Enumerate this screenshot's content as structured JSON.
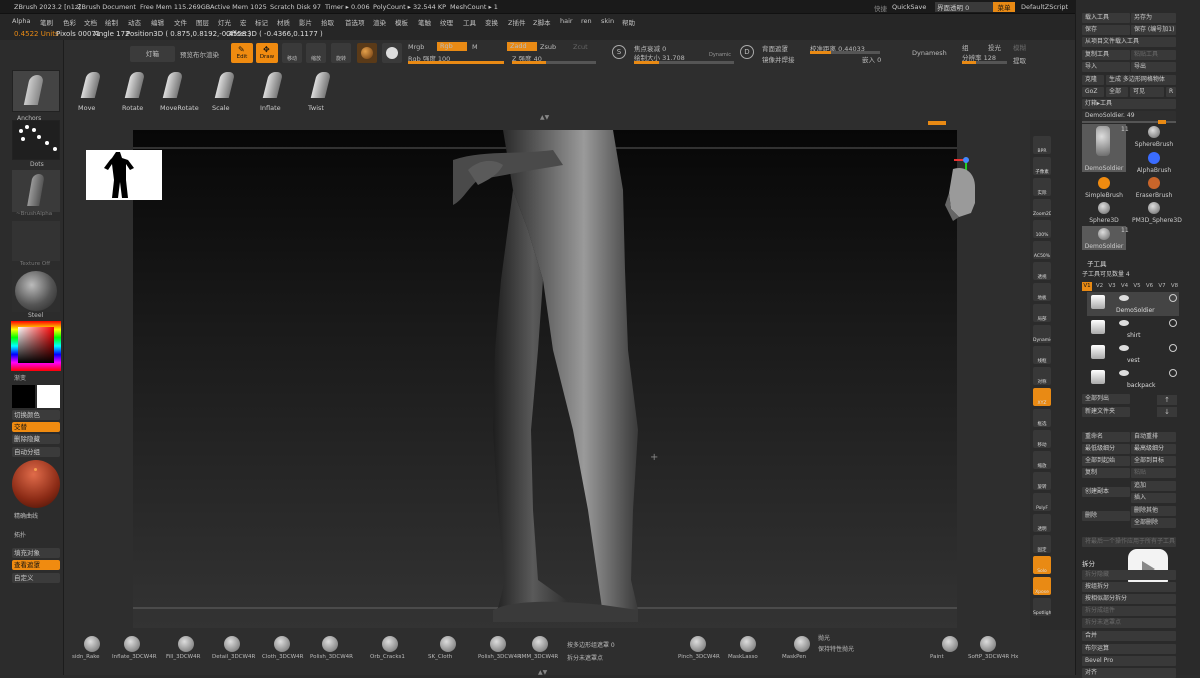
{
  "title_bar": {
    "app": "ZBrush 2023.2 [n1z]",
    "doc": "ZBrush Document",
    "free_mem": "Free Mem 115.269GB",
    "active_mem": "Active Mem 1025",
    "scratch": "Scratch Disk 97",
    "timer": "Timer ▸ 0.006",
    "polycount": "PolyCount ▸ 32.544 KP",
    "meshcount": "MeshCount ▸ 1",
    "quicksave_label": "快捷",
    "quicksave": "QuickSave",
    "transparency": "界面透明 0",
    "menu_btn": "菜单",
    "script": "DefaultZScript"
  },
  "menu": [
    "Alpha",
    "笔刷",
    "色彩",
    "文档",
    "绘制",
    "动态",
    "编辑",
    "文件",
    "图层",
    "灯光",
    "宏",
    "标记",
    "材质",
    "影片",
    "拾取",
    "首选项",
    "渲染",
    "模板",
    "笔触",
    "纹理",
    "工具",
    "变换",
    "Z插件",
    "Z脚本",
    "hair",
    "ren",
    "skin",
    "帮助"
  ],
  "info": {
    "units": "0.4522 Units",
    "pixols": "Pixols 00071",
    "angle": "Angle 172",
    "position": "Position3D ( 0.875,0.8192,-0.4558 )",
    "offset": "Offset3D ( -0.4366,0.1177 )"
  },
  "top_shelf": {
    "light_box": "灯箱",
    "preview_render": "预览布尔渲染",
    "edit": "Edit",
    "draw": "Draw",
    "move_t": "移动",
    "scale_t": "缩放",
    "rotate_t": "旋转",
    "mrgb": "Mrgb",
    "rgb": "Rgb",
    "m": "M",
    "rgb_intensity": "Rgb 强度 100",
    "zadd": "Zadd",
    "zsub": "Zsub",
    "zcut": "Zcut",
    "z_intensity": "Z 强度 40",
    "focal": "焦点衰减 0",
    "draw_size": "绘制大小 31.708",
    "dynamic": "Dynamic",
    "backface": "背面遮罩",
    "mask_backface": "镜像并焊接",
    "lazy": "校准距离 0.44033",
    "insert": "嵌入 0",
    "dynamesh": "Dynamesh",
    "group": "组",
    "project": "投光",
    "blur": "模糊",
    "resolution": "分辨率 128",
    "extract": "提取"
  },
  "brushes": [
    "Move",
    "Rotate",
    "MoveRotate",
    "Scale",
    "Inflate",
    "Twist"
  ],
  "left_shelf": {
    "anchors": "Anchors",
    "dots": "Dots",
    "brush_alpha": "~BrushAlpha",
    "texture_off": "Texture Off",
    "steel": "Steel",
    "gradient": "渐变",
    "switch_color": "切换颜色",
    "alternate": "交替",
    "delete_hidden": "删除隐藏",
    "auto_group": "自动分组",
    "precision_curve": "精确曲线",
    "topology": "拓扑",
    "fill_object": "填充对象",
    "view_mask": "查看遮罩",
    "custom": "自定义"
  },
  "right_shelf": [
    "BPR",
    "子像素",
    "实际",
    "Zoom2D",
    "100%",
    "AC50%",
    "透视",
    "地板",
    "局部",
    "Dynamic",
    "线框",
    "对称",
    "XYZ",
    "框选",
    "移动",
    "缩放",
    "旋转",
    "PolyF",
    "透明",
    "固定",
    "Solo",
    "Xpose",
    "Spotlight"
  ],
  "bottom_shelf": {
    "brushes": [
      "sidn_Rake",
      "Inflate_3DCW4R",
      "Fill_3DCW4R",
      "Detail_3DCW4R",
      "Cloth_3DCW4R",
      "Polish_3DCW4R",
      "Orb_Cracks1",
      "SK_Cloth",
      "Polish_3DCW4R",
      "IMM_3DCW4R",
      "Pinch_3DCW4R",
      "MaskLasso",
      "MaskPen",
      "Paint",
      "SoftP_3DCW4R Hx"
    ],
    "polygroup_mask": "按多边形组遮罩 0",
    "apply_mask": "拆分未遮罩点",
    "shine": "抛光",
    "follow_poly": "保持特性抛光"
  },
  "right_panel": {
    "load_tool": "载入工具",
    "save_as": "另存为",
    "save": "保存",
    "save_n": "保存 (编号加1)",
    "load_from_project": "从项目文件载入工具",
    "copy_tool": "复制工具",
    "paste_tool": "粘贴工具",
    "import": "导入",
    "export": "导出",
    "clone": "克隆",
    "make_polymesh": "生成 多边形网格物体",
    "goz": "GoZ",
    "all": "全部",
    "visible": "可见",
    "r": "R",
    "lightbox_tools": "灯箱▸工具",
    "current_tool": "DemoSoldier. 49",
    "tools": [
      "DemoSoldier",
      "SphereBrush",
      "AlphaBrush",
      "SimpleBrush",
      "EraserBrush",
      "Sphere3D",
      "PM3D_Sphere3D",
      "DemoSoldier"
    ],
    "tool_count_1": "11",
    "tool_count_2": "11",
    "subtool_title": "子工具",
    "subtool_visible_count": "子工具可见数量 4",
    "tabs": [
      "V1",
      "V2",
      "V3",
      "V4",
      "V5",
      "V6",
      "V7",
      "V8"
    ],
    "subtools": [
      "DemoSoldier",
      "shirt",
      "vest",
      "backpack"
    ],
    "list_all": "全部列出",
    "new_folder": "新建文件夹",
    "rename": "重命名",
    "auto_reorder": "自动重排",
    "lowest_subdiv": "最低级细分",
    "highest_subdiv": "最高级细分",
    "all_to_lowest": "全部到起始",
    "all_to_target": "全部到目标",
    "duplicate": "复制",
    "paste": "粘贴",
    "append": "追加",
    "create_copy": "创建副本",
    "insert": "插入",
    "delete": "删除",
    "delete_other": "删除其他",
    "delete_all": "全部删除",
    "move_up": "将最后一个操作应用于所有子工具",
    "split_section": "拆分",
    "split_hidden": "拆分隐藏",
    "groups_split": "按组拆分",
    "split_similar": "按相似部分拆分",
    "split_to_parts": "拆分成组件",
    "split_unmasked": "拆分未遮罩点",
    "split_masked": "拆分已遮罩点",
    "merge": "合并",
    "boolean": "布尔运算",
    "bevel_pro": "Bevel Pro",
    "align": "对齐"
  }
}
